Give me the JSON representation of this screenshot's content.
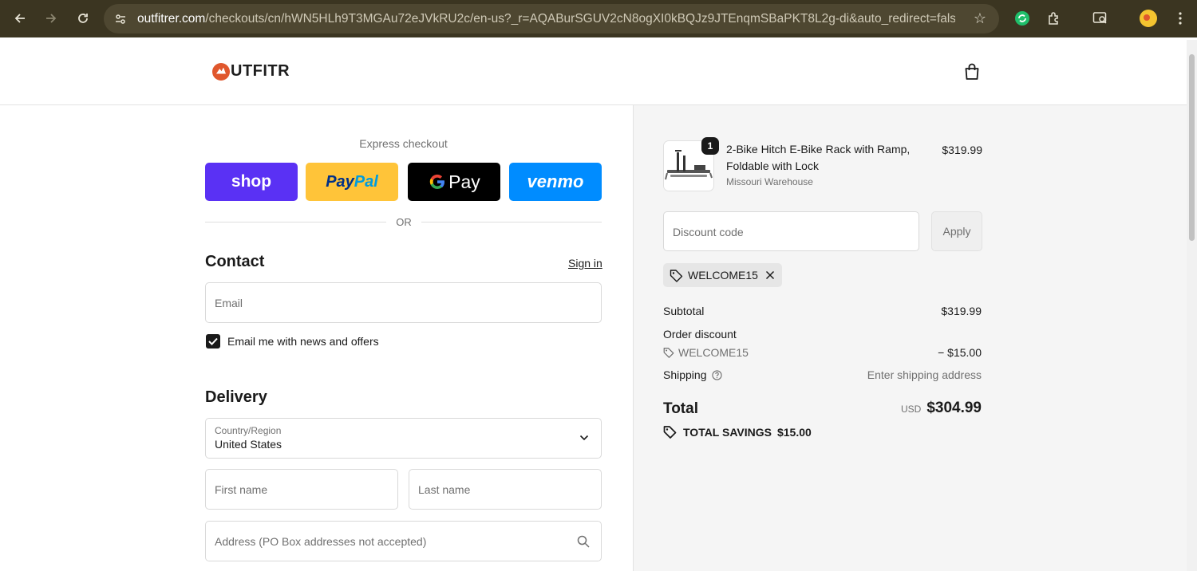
{
  "browser": {
    "url_host": "outfitrer.com",
    "url_rest": "/checkouts/cn/hWN5HLh9T3MGAu72eJVkRU2c/en-us?_r=AQABurSGUV2cN8ogXI0kBQJz9JTEnqmSBaPKT8L2g-di&auto_redirect=false&..."
  },
  "header": {
    "logo_text": "UTFITR"
  },
  "express": {
    "title": "Express checkout",
    "shop_label": "shop",
    "paypal_label_1": "Pay",
    "paypal_label_2": "Pal",
    "gpay_label": "Pay",
    "venmo_label": "venmo",
    "or_label": "OR"
  },
  "contact": {
    "heading": "Contact",
    "signin_label": "Sign in",
    "email_placeholder": "Email",
    "newsletter_label": "Email me with news and offers",
    "newsletter_checked": true
  },
  "delivery": {
    "heading": "Delivery",
    "country_label": "Country/Region",
    "country_value": "United States",
    "first_name_placeholder": "First name",
    "last_name_placeholder": "Last name",
    "address_placeholder": "Address (PO Box addresses not accepted)"
  },
  "summary": {
    "item": {
      "quantity": "1",
      "name": "2-Bike Hitch E-Bike Rack with Ramp, Foldable with Lock",
      "variant": "Missouri Warehouse",
      "price": "$319.99"
    },
    "discount_placeholder": "Discount code",
    "apply_label": "Apply",
    "applied_code": "WELCOME15",
    "subtotal_label": "Subtotal",
    "subtotal_value": "$319.99",
    "order_discount_label": "Order discount",
    "order_discount_code": "WELCOME15",
    "order_discount_value": "− $15.00",
    "shipping_label": "Shipping",
    "shipping_value": "Enter shipping address",
    "total_label": "Total",
    "total_currency": "USD",
    "total_value": "$304.99",
    "savings_label": "TOTAL SAVINGS",
    "savings_value": "$15.00"
  },
  "colors": {
    "shop": "#5a31f4",
    "paypal": "#ffc439",
    "gpay": "#000000",
    "venmo": "#008cff",
    "summary_bg": "#f5f5f5",
    "browser_frame": "#3b3521"
  }
}
